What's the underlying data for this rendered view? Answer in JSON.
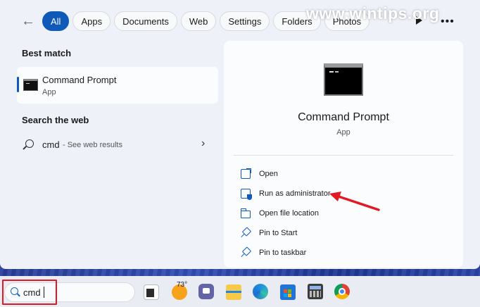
{
  "watermark": "www.wintips.org",
  "filters": {
    "back_icon": "back-arrow-icon",
    "chips": [
      {
        "label": "All",
        "active": true
      },
      {
        "label": "Apps",
        "active": false
      },
      {
        "label": "Documents",
        "active": false
      },
      {
        "label": "Web",
        "active": false
      },
      {
        "label": "Settings",
        "active": false
      },
      {
        "label": "Folders",
        "active": false
      },
      {
        "label": "Photos",
        "active": false
      }
    ],
    "play_icon": "play-icon",
    "more_icon": "more-options-icon"
  },
  "best_match": {
    "heading": "Best match",
    "name": "Command Prompt",
    "type": "App",
    "icon": "command-prompt-icon"
  },
  "search_web": {
    "heading": "Search the web",
    "query": "cmd",
    "hint": "- See web results",
    "icon": "search-icon",
    "chevron": "›"
  },
  "detail": {
    "title": "Command Prompt",
    "subtitle": "App",
    "actions": [
      {
        "label": "Open",
        "icon": "open-icon"
      },
      {
        "label": "Run as administrator",
        "icon": "shield-admin-icon"
      },
      {
        "label": "Open file location",
        "icon": "folder-icon"
      },
      {
        "label": "Pin to Start",
        "icon": "pin-icon"
      },
      {
        "label": "Pin to taskbar",
        "icon": "pin-icon"
      }
    ]
  },
  "taskbar": {
    "search_value": "cmd",
    "weather_temp": "73°",
    "apps": [
      "task-view-icon",
      "weather-icon",
      "teams-chat-icon",
      "file-explorer-icon",
      "edge-icon",
      "store-icon",
      "calculator-icon",
      "chrome-icon"
    ]
  },
  "colors": {
    "accent": "#0f5ab8",
    "annotation_red": "#e01b24"
  }
}
